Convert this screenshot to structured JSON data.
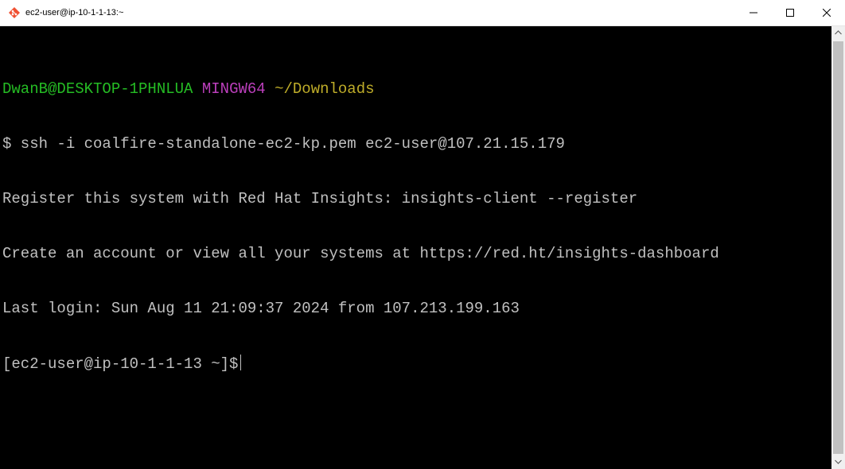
{
  "window": {
    "title": "ec2-user@ip-10-1-1-13:~",
    "icon": "git-bash-icon",
    "controls": [
      "minimize-icon",
      "maximize-icon",
      "close-icon"
    ]
  },
  "terminal": {
    "prompt_user_host": "DwanB@DESKTOP-1PHNLUA",
    "prompt_env": "MINGW64",
    "prompt_path": "~/Downloads",
    "command_line": "$ ssh -i coalfire-standalone-ec2-kp.pem ec2-user@107.21.15.179",
    "output_1": "Register this system with Red Hat Insights: insights-client --register",
    "output_2": "Create an account or view all your systems at https://red.ht/insights-dashboard",
    "output_3": "Last login: Sun Aug 11 21:09:37 2024 from 107.213.199.163",
    "remote_prompt": "[ec2-user@ip-10-1-1-13 ~]$"
  },
  "colors": {
    "background": "#000000",
    "text": "#c0c0c0",
    "user_host": "#25bc24",
    "env": "#bc3fbc",
    "path": "#bfad29"
  }
}
